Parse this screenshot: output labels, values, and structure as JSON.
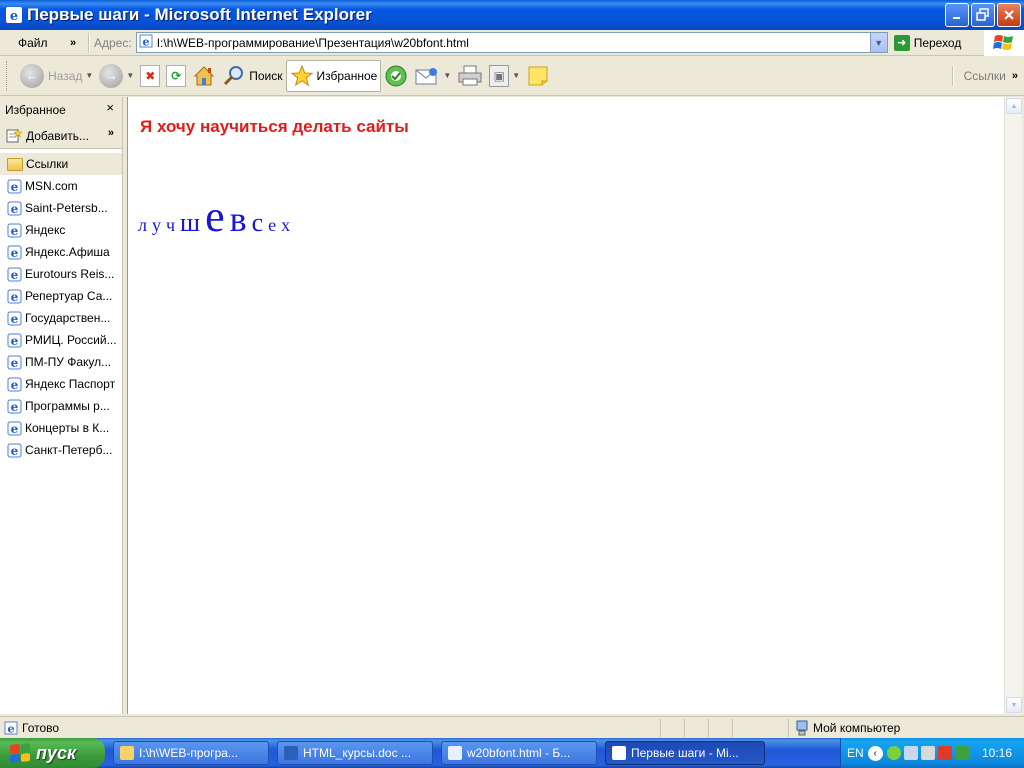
{
  "window": {
    "title": "Первые шаги - Microsoft Internet Explorer"
  },
  "menu": {
    "file": "Файл",
    "chevron": "»"
  },
  "address": {
    "label": "Адрес:",
    "url": "I:\\h\\WEB-программирование\\Презентация\\w20bfont.html",
    "go": "Переход"
  },
  "toolbar": {
    "back": "Назад",
    "search": "Поиск",
    "favorites": "Избранное",
    "links": "Ссылки",
    "chevron": "»"
  },
  "favorites_pane": {
    "title": "Избранное",
    "close": "×",
    "add": "Добавить...",
    "add_chevron": "»",
    "folder": "Ссылки",
    "items": [
      "MSN.com",
      "Saint-Petersb...",
      "Яндекс",
      "Яндекс.Афиша",
      "Eurotours Reis...",
      "Репертуар Са...",
      "Государствен...",
      "РМИЦ. Россий...",
      "ПМ-ПУ  Факул...",
      "Яндекс Паспорт",
      "Программы р...",
      "Концерты в К...",
      "Санкт-Петерб..."
    ]
  },
  "content": {
    "heading": "Я хочу научиться делать сайты",
    "heading_color": "#e31b1b",
    "letters_color": "#1616d4",
    "letters": [
      {
        "char": "л",
        "size": 18
      },
      {
        "char": "у",
        "size": 18
      },
      {
        "char": "ч",
        "size": 18
      },
      {
        "char": "ш",
        "size": 26
      },
      {
        "char": "е",
        "size": 44
      },
      {
        "char": "в",
        "size": 36
      },
      {
        "char": "с",
        "size": 26
      },
      {
        "char": "е",
        "size": 18
      },
      {
        "char": "х",
        "size": 18
      }
    ]
  },
  "status": {
    "ready": "Готово",
    "zone": "Мой компьютер"
  },
  "taskbar": {
    "start": "пуск",
    "tasks": [
      {
        "label": "I:\\h\\WEB-програ...",
        "active": false
      },
      {
        "label": "HTML_курсы.doc ...",
        "active": false
      },
      {
        "label": "w20bfont.html - Б...",
        "active": false
      },
      {
        "label": "Первые шаги - Mi...",
        "active": true
      }
    ],
    "lang": "EN",
    "clock": "10:16"
  }
}
